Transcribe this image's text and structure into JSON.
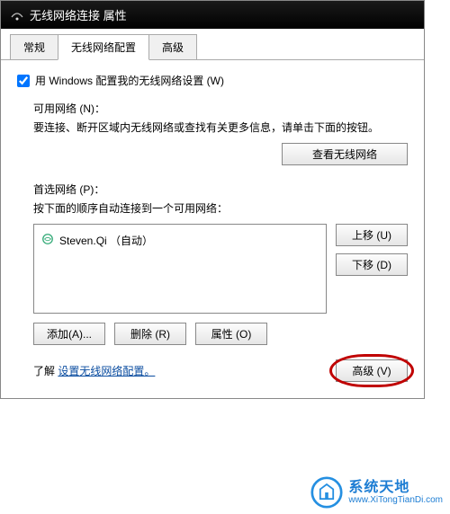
{
  "window": {
    "title": "无线网络连接 属性"
  },
  "tabs": {
    "general": "常规",
    "wireless_config": "无线网络配置",
    "advanced": "高级"
  },
  "checkbox": {
    "label": "用 Windows 配置我的无线网络设置 (W)"
  },
  "available": {
    "heading": "可用网络 (N)：",
    "help": "要连接、断开区域内无线网络或查找有关更多信息，请单击下面的按钮。",
    "view_button": "查看无线网络"
  },
  "preferred": {
    "heading": "首选网络 (P)：",
    "help": "按下面的顺序自动连接到一个可用网络：",
    "networks": [
      {
        "name": "Steven.Qi （自动）"
      }
    ],
    "move_up": "上移 (U)",
    "move_down": "下移 (D)",
    "add": "添加(A)...",
    "remove": "删除 (R)",
    "properties": "属性 (O)"
  },
  "footer": {
    "learn_prefix": "了解",
    "learn_link": "设置无线网络配置。",
    "advanced_button": "高级 (V)"
  },
  "watermark": {
    "brand": "系统天地",
    "url": "www.XiTongTianDi.com"
  }
}
